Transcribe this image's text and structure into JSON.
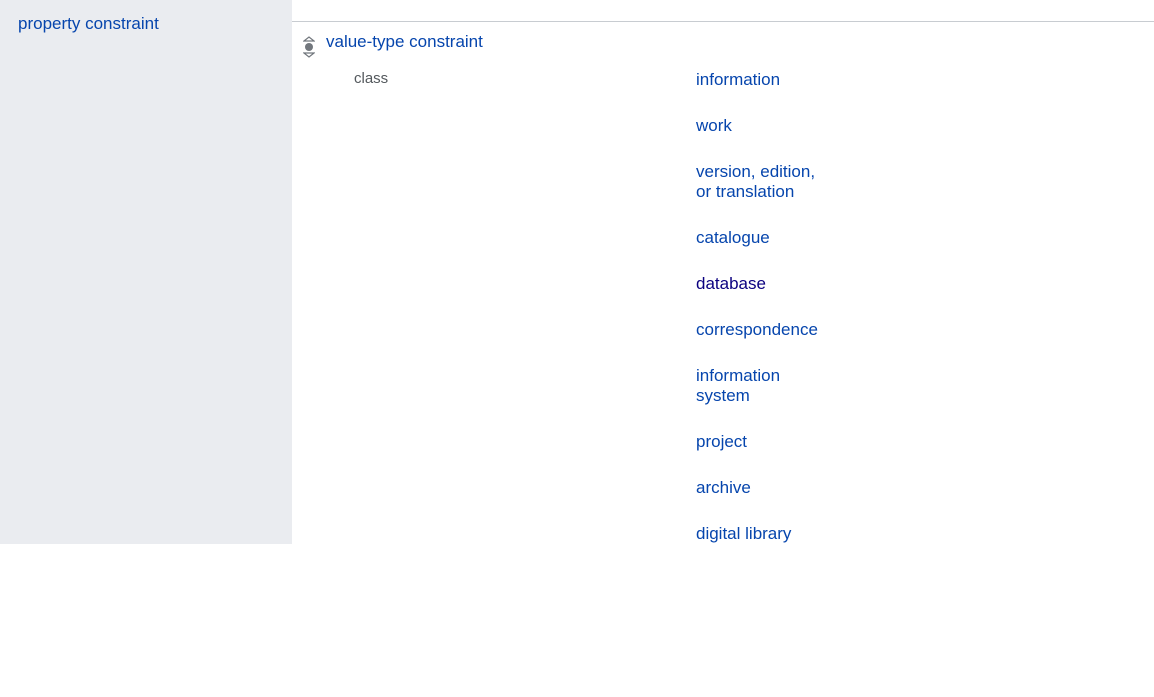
{
  "property": {
    "label": "property constraint"
  },
  "claim": {
    "mainsnak_label": "value-type constraint",
    "qualifier_label": "class",
    "qualifier_values": [
      {
        "text": "information",
        "visited": false
      },
      {
        "text": "work",
        "visited": false
      },
      {
        "text": "version, edition, or translation",
        "visited": false
      },
      {
        "text": "catalogue",
        "visited": false
      },
      {
        "text": "database",
        "visited": true
      },
      {
        "text": "correspondence",
        "visited": false
      },
      {
        "text": "information system",
        "visited": false
      },
      {
        "text": "project",
        "visited": false
      },
      {
        "text": "archive",
        "visited": false
      },
      {
        "text": "digital library",
        "visited": false
      }
    ]
  }
}
